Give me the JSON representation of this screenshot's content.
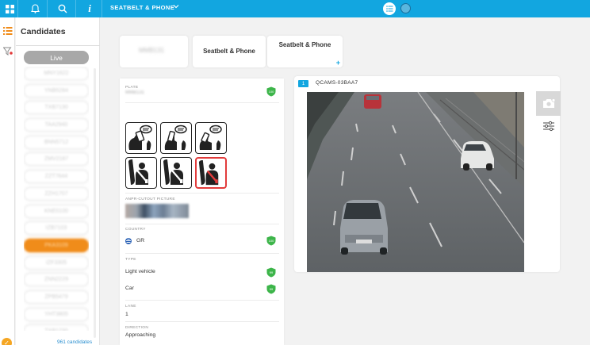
{
  "topbar": {
    "title": "SEATBELT & PHONE",
    "icons": [
      "grid-icon",
      "bell-icon",
      "search-icon",
      "info-icon",
      "chevron-down-icon",
      "list-icon",
      "globe-icon"
    ],
    "colors": {
      "accent": "#12a6e0"
    }
  },
  "sidebar": {
    "icons": [
      "list-icon",
      "filter-icon"
    ]
  },
  "candidates": {
    "title": "Candidates",
    "live_label": "Live",
    "count_text": "961 candidates",
    "items": [
      "MNY1622",
      "YNB5284",
      "TXB7130",
      "TAA2940",
      "BNN5712",
      "ZMV2187",
      "ZZT7644",
      "ZZH1707",
      "KNE0100",
      "IZB7103",
      "PKA3109",
      "IZF3305",
      "ZNN2229",
      "ZPB5479",
      "YHT3805",
      "TXB1230"
    ],
    "active_index": 10,
    "colors": {
      "active": "#f08c1a",
      "link": "#2a8fd0"
    }
  },
  "tabs": {
    "main_blurred": "MMB131",
    "items": [
      {
        "label": "Seatbelt & Phone"
      },
      {
        "label": "Seatbelt & Phone",
        "plus": "+"
      }
    ]
  },
  "info": {
    "plate": {
      "label": "PLATE",
      "value": "MMB131",
      "score": "100"
    },
    "cutout_label": "ANPR-CUTOUT PICTURE",
    "country": {
      "label": "COUNTRY",
      "value": "GR",
      "score": "100"
    },
    "type": {
      "label": "TYPE",
      "value1": "Light vehicle",
      "score1": "99",
      "value2": "Car",
      "score2": "99"
    },
    "lane": {
      "label": "LANE",
      "value": "1"
    },
    "direction": {
      "label": "DIRECTION",
      "value": "Approaching"
    },
    "pictograms": [
      "phone-hand-icon",
      "phone-hand-icon",
      "phone-hand-icon",
      "seatbelt-icon",
      "seatbelt-icon",
      "seatbelt-alert-icon"
    ],
    "colors": {
      "shield": "#3db54a",
      "alert": "#e23b3b"
    }
  },
  "video": {
    "badge": "1",
    "camera_name": "QCAMS-03BAA7",
    "tools": [
      "camera-add-icon",
      "sliders-icon"
    ]
  }
}
